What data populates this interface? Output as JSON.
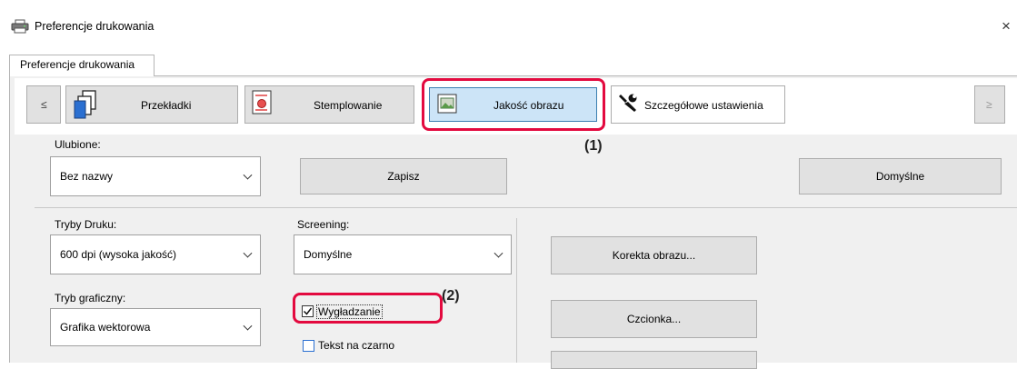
{
  "window": {
    "title": "Preferencje drukowania",
    "close_symbol": "×"
  },
  "tabs": [
    {
      "label": "Preferencje drukowania"
    }
  ],
  "nav": {
    "prev": "≤",
    "next": "≥",
    "buttons": [
      {
        "label": "Przekładki"
      },
      {
        "label": "Stemplowanie"
      },
      {
        "label": "Jakość obrazu"
      },
      {
        "label": "Szczegółowe ustawienia"
      }
    ]
  },
  "favorites": {
    "label": "Ulubione:",
    "value": "Bez nazwy",
    "save": "Zapisz",
    "default": "Domyślne"
  },
  "print_mode": {
    "label": "Tryby Druku:",
    "value": "600 dpi (wysoka jakość)"
  },
  "screening": {
    "label": "Screening:",
    "value": "Domyślne"
  },
  "graphics_mode": {
    "label": "Tryb graficzny:",
    "value": "Grafika wektorowa"
  },
  "smoothing": {
    "label": "Wygładzanie",
    "checked": true
  },
  "text_black": {
    "label": "Tekst na czarno",
    "checked": false
  },
  "image_correction": "Korekta obrazu...",
  "font": "Czcionka...",
  "callouts": {
    "one": "(1)",
    "two": "(2)"
  },
  "colors": {
    "highlight": "#e30a3f",
    "selected": "#cce4f7"
  }
}
